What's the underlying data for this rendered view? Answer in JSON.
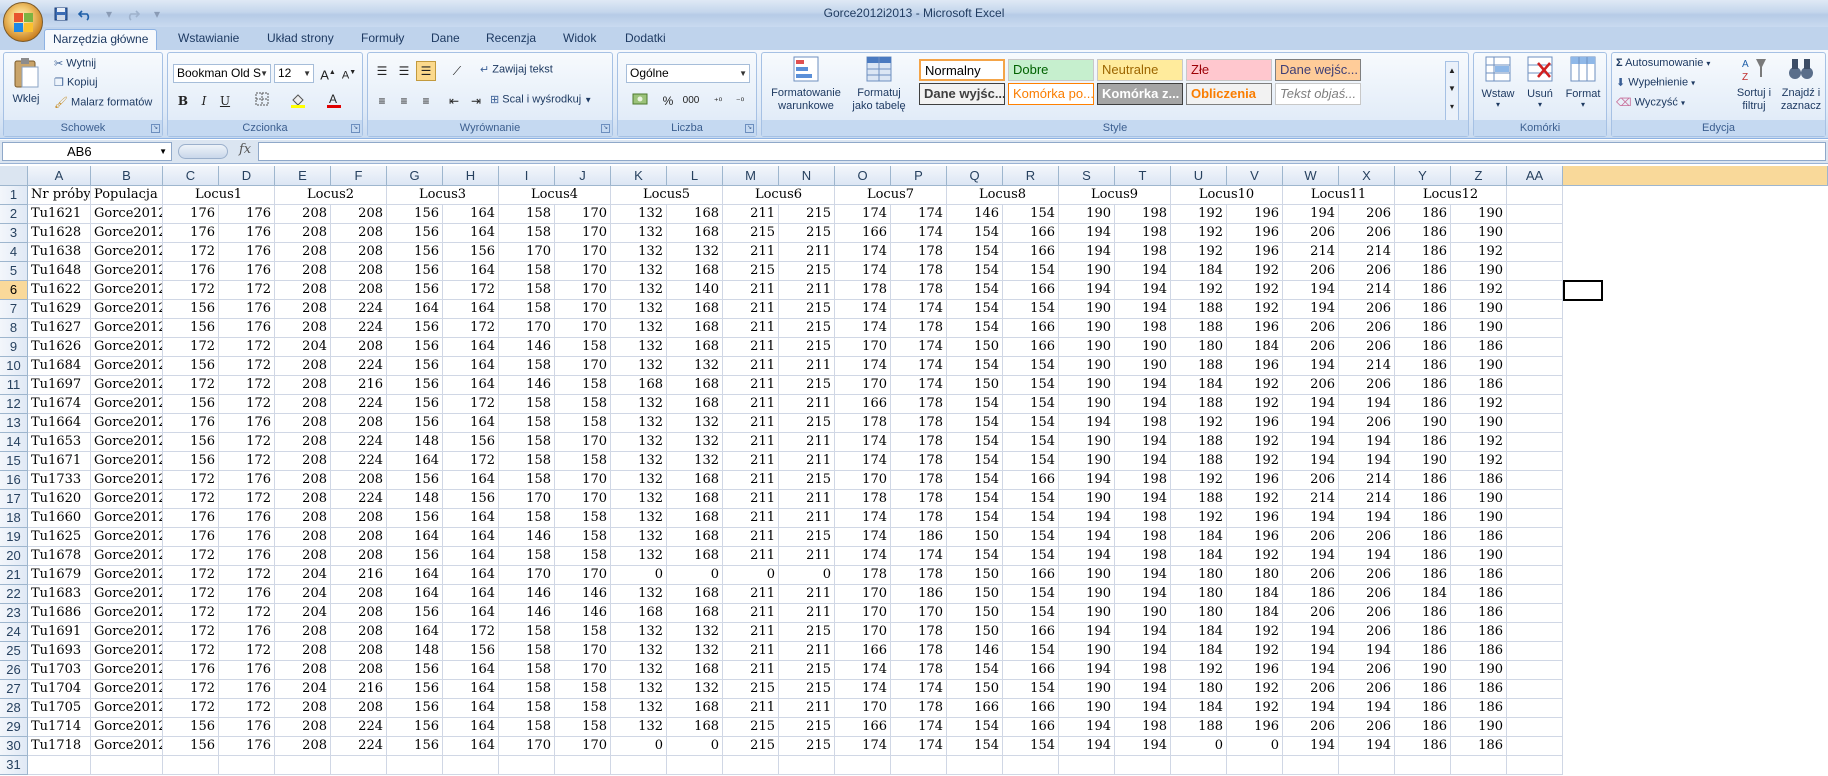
{
  "window": {
    "title": "Gorce2012i2013 - Microsoft Excel"
  },
  "qat": [
    "save-icon",
    "undo-icon",
    "redo-icon"
  ],
  "tabs": [
    {
      "label": "Narzędzia główne",
      "active": true
    },
    {
      "label": "Wstawianie"
    },
    {
      "label": "Układ strony"
    },
    {
      "label": "Formuły"
    },
    {
      "label": "Dane"
    },
    {
      "label": "Recenzja"
    },
    {
      "label": "Widok"
    },
    {
      "label": "Dodatki"
    }
  ],
  "ribbon": {
    "clipboard": {
      "label": "Schowek",
      "paste": "Wklej",
      "cut": "Wytnij",
      "copy": "Kopiuj",
      "format_painter": "Malarz formatów"
    },
    "font": {
      "label": "Czcionka",
      "name": "Bookman Old S",
      "size": "12",
      "bold": "B",
      "italic": "I",
      "underline": "U"
    },
    "alignment": {
      "label": "Wyrównanie",
      "wrap": "Zawijaj tekst",
      "merge": "Scal i wyśrodkuj"
    },
    "number": {
      "label": "Liczba",
      "format": "Ogólne",
      "percent": "%",
      "thousands": "000"
    },
    "styles": {
      "label": "Style",
      "conditional": "Formatowanie warunkowe",
      "as_table": "Formatuj jako tabelę",
      "cells": [
        {
          "label": "Normalny",
          "bg": "#ffffff",
          "color": "#000000",
          "border": "#f4a448"
        },
        {
          "label": "Dobre",
          "bg": "#c6efce",
          "color": "#006100"
        },
        {
          "label": "Neutralne",
          "bg": "#ffeb9c",
          "color": "#9c6500"
        },
        {
          "label": "Złe",
          "bg": "#ffc7ce",
          "color": "#9c0006"
        },
        {
          "label": "Dane wejśc...",
          "bg": "#ffcc99",
          "color": "#3f3f76",
          "border": "#7f7f7f"
        },
        {
          "label": "Dane wyjśc...",
          "bg": "#f2f2f2",
          "color": "#3f3f3f",
          "border": "#3f3f3f",
          "bold": true
        },
        {
          "label": "Komórka po...",
          "bg": "#ffffff",
          "color": "#fa7d00",
          "border": "#ff8001"
        },
        {
          "label": "Komórka z...",
          "bg": "#a5a5a5",
          "color": "#ffffff",
          "border": "#3f3f3f",
          "bold": true
        },
        {
          "label": "Obliczenia",
          "bg": "#f2f2f2",
          "color": "#fa7d00",
          "border": "#7f7f7f",
          "bold": true
        },
        {
          "label": "Tekst objaś...",
          "bg": "#ffffff",
          "color": "#7f7f7f",
          "italic": true
        }
      ]
    },
    "cells_group": {
      "label": "Komórki",
      "insert": "Wstaw",
      "delete": "Usuń",
      "format": "Format"
    },
    "editing": {
      "label": "Edycja",
      "autosum": "Autosumowanie",
      "fill": "Wypełnienie",
      "clear": "Wyczyść",
      "sort": "Sortuj i filtruj",
      "find": "Znajdź i zaznacz"
    }
  },
  "formula_bar": {
    "name_box": "AB6",
    "fx": "fx",
    "formula": ""
  },
  "selection": {
    "column": "AB",
    "row": "6"
  },
  "columns": [
    "A",
    "B",
    "C",
    "D",
    "E",
    "F",
    "G",
    "H",
    "I",
    "J",
    "K",
    "L",
    "M",
    "N",
    "O",
    "P",
    "Q",
    "R",
    "S",
    "T",
    "U",
    "V",
    "W",
    "X",
    "Y",
    "Z",
    "AA"
  ],
  "header_row": {
    "a": "Nr próby",
    "b": "Populacja",
    "loci": [
      "Locus1",
      "Locus2",
      "Locus3",
      "Locus4",
      "Locus5",
      "Locus6",
      "Locus7",
      "Locus8",
      "Locus9",
      "Locus10",
      "Locus11",
      "Locus12"
    ]
  },
  "rows": [
    [
      "Tu1621",
      "Gorce2012",
      176,
      176,
      208,
      208,
      156,
      164,
      158,
      170,
      132,
      168,
      211,
      215,
      174,
      174,
      146,
      154,
      190,
      198,
      192,
      196,
      194,
      206,
      186,
      190
    ],
    [
      "Tu1628",
      "Gorce2012",
      176,
      176,
      208,
      208,
      156,
      164,
      158,
      170,
      132,
      168,
      215,
      215,
      166,
      174,
      154,
      166,
      194,
      198,
      192,
      196,
      206,
      206,
      186,
      190
    ],
    [
      "Tu1638",
      "Gorce2012",
      172,
      176,
      208,
      208,
      156,
      156,
      170,
      170,
      132,
      132,
      211,
      211,
      174,
      178,
      154,
      166,
      194,
      198,
      192,
      196,
      214,
      214,
      186,
      192
    ],
    [
      "Tu1648",
      "Gorce2012",
      176,
      176,
      208,
      208,
      156,
      164,
      158,
      170,
      132,
      168,
      215,
      215,
      174,
      178,
      154,
      154,
      190,
      194,
      184,
      192,
      206,
      206,
      186,
      190
    ],
    [
      "Tu1622",
      "Gorce2012",
      172,
      172,
      208,
      208,
      156,
      172,
      158,
      170,
      132,
      140,
      211,
      211,
      178,
      178,
      154,
      166,
      194,
      194,
      192,
      192,
      194,
      214,
      186,
      192
    ],
    [
      "Tu1629",
      "Gorce2012",
      156,
      176,
      208,
      224,
      164,
      164,
      158,
      170,
      132,
      168,
      211,
      215,
      174,
      174,
      154,
      154,
      190,
      194,
      188,
      192,
      194,
      206,
      186,
      190
    ],
    [
      "Tu1627",
      "Gorce2012",
      156,
      176,
      208,
      224,
      156,
      172,
      170,
      170,
      132,
      168,
      211,
      215,
      174,
      178,
      154,
      166,
      190,
      198,
      188,
      196,
      206,
      206,
      186,
      190
    ],
    [
      "Tu1626",
      "Gorce2012",
      172,
      172,
      204,
      208,
      156,
      164,
      146,
      158,
      132,
      168,
      211,
      215,
      170,
      174,
      150,
      166,
      190,
      190,
      180,
      184,
      206,
      206,
      186,
      186
    ],
    [
      "Tu1684",
      "Gorce2012",
      156,
      172,
      208,
      224,
      156,
      164,
      158,
      170,
      132,
      132,
      211,
      211,
      174,
      174,
      154,
      154,
      190,
      190,
      188,
      196,
      194,
      214,
      186,
      190
    ],
    [
      "Tu1697",
      "Gorce2012",
      172,
      172,
      208,
      216,
      156,
      164,
      146,
      158,
      168,
      168,
      211,
      215,
      170,
      174,
      150,
      154,
      190,
      194,
      184,
      192,
      206,
      206,
      186,
      186
    ],
    [
      "Tu1674",
      "Gorce2012",
      156,
      172,
      208,
      224,
      156,
      172,
      158,
      158,
      132,
      168,
      211,
      211,
      166,
      178,
      154,
      154,
      190,
      194,
      188,
      192,
      194,
      194,
      186,
      192
    ],
    [
      "Tu1664",
      "Gorce2012",
      176,
      176,
      208,
      208,
      156,
      164,
      158,
      158,
      132,
      132,
      211,
      215,
      178,
      178,
      154,
      154,
      194,
      198,
      192,
      196,
      194,
      206,
      190,
      190
    ],
    [
      "Tu1653",
      "Gorce2012",
      156,
      172,
      208,
      224,
      148,
      156,
      158,
      170,
      132,
      132,
      211,
      211,
      174,
      178,
      154,
      154,
      190,
      194,
      188,
      192,
      194,
      194,
      186,
      192
    ],
    [
      "Tu1671",
      "Gorce2012",
      156,
      172,
      208,
      224,
      164,
      172,
      158,
      158,
      132,
      132,
      211,
      211,
      174,
      178,
      154,
      154,
      190,
      194,
      188,
      192,
      194,
      194,
      190,
      192
    ],
    [
      "Tu1733",
      "Gorce2012",
      172,
      176,
      208,
      208,
      156,
      164,
      158,
      170,
      132,
      168,
      211,
      215,
      170,
      178,
      154,
      166,
      194,
      198,
      192,
      196,
      206,
      214,
      186,
      186
    ],
    [
      "Tu1620",
      "Gorce2012",
      172,
      172,
      208,
      224,
      148,
      156,
      170,
      170,
      132,
      168,
      211,
      211,
      178,
      178,
      154,
      154,
      190,
      194,
      188,
      192,
      214,
      214,
      186,
      190
    ],
    [
      "Tu1660",
      "Gorce2012",
      176,
      176,
      208,
      208,
      156,
      164,
      158,
      158,
      132,
      168,
      211,
      211,
      174,
      178,
      154,
      154,
      194,
      198,
      192,
      196,
      194,
      194,
      186,
      190
    ],
    [
      "Tu1625",
      "Gorce2012",
      176,
      176,
      208,
      208,
      164,
      164,
      146,
      158,
      132,
      168,
      211,
      215,
      174,
      186,
      150,
      154,
      194,
      198,
      184,
      196,
      206,
      206,
      186,
      186
    ],
    [
      "Tu1678",
      "Gorce2012",
      172,
      176,
      208,
      208,
      156,
      164,
      158,
      158,
      132,
      168,
      211,
      211,
      174,
      174,
      154,
      154,
      194,
      198,
      184,
      192,
      194,
      194,
      186,
      190
    ],
    [
      "Tu1679",
      "Gorce2012",
      172,
      172,
      204,
      216,
      164,
      164,
      170,
      170,
      0,
      0,
      0,
      0,
      178,
      178,
      150,
      166,
      190,
      194,
      180,
      180,
      206,
      206,
      186,
      186
    ],
    [
      "Tu1683",
      "Gorce2012",
      172,
      176,
      204,
      208,
      164,
      164,
      146,
      146,
      132,
      168,
      211,
      211,
      170,
      186,
      150,
      154,
      190,
      194,
      180,
      184,
      186,
      206,
      184,
      186
    ],
    [
      "Tu1686",
      "Gorce2012",
      172,
      172,
      204,
      208,
      156,
      164,
      146,
      146,
      168,
      168,
      211,
      211,
      170,
      170,
      150,
      154,
      190,
      190,
      180,
      184,
      206,
      206,
      186,
      186
    ],
    [
      "Tu1691",
      "Gorce2012",
      172,
      176,
      208,
      208,
      164,
      172,
      158,
      158,
      132,
      132,
      211,
      215,
      170,
      178,
      150,
      166,
      194,
      194,
      184,
      192,
      194,
      206,
      186,
      186
    ],
    [
      "Tu1693",
      "Gorce2012",
      172,
      172,
      208,
      208,
      148,
      156,
      158,
      170,
      132,
      132,
      211,
      211,
      166,
      178,
      146,
      154,
      190,
      194,
      184,
      192,
      194,
      194,
      186,
      186
    ],
    [
      "Tu1703",
      "Gorce2012",
      176,
      176,
      208,
      208,
      156,
      164,
      158,
      170,
      132,
      168,
      211,
      215,
      174,
      178,
      154,
      166,
      194,
      198,
      192,
      196,
      194,
      206,
      190,
      190
    ],
    [
      "Tu1704",
      "Gorce2012",
      172,
      176,
      204,
      216,
      156,
      164,
      158,
      158,
      132,
      132,
      215,
      215,
      174,
      174,
      150,
      154,
      190,
      194,
      180,
      192,
      206,
      206,
      186,
      186
    ],
    [
      "Tu1705",
      "Gorce2012",
      172,
      172,
      208,
      208,
      156,
      164,
      158,
      158,
      132,
      168,
      211,
      211,
      170,
      178,
      166,
      166,
      190,
      194,
      184,
      192,
      194,
      194,
      186,
      186
    ],
    [
      "Tu1714",
      "Gorce2012",
      156,
      176,
      208,
      224,
      156,
      164,
      158,
      158,
      132,
      168,
      215,
      215,
      166,
      174,
      154,
      166,
      194,
      198,
      188,
      196,
      206,
      206,
      186,
      190
    ],
    [
      "Tu1718",
      "Gorce2012",
      156,
      176,
      208,
      224,
      156,
      164,
      170,
      170,
      0,
      0,
      215,
      215,
      174,
      174,
      154,
      154,
      194,
      194,
      0,
      0,
      194,
      194,
      186,
      186
    ]
  ],
  "last_row_number": "31"
}
